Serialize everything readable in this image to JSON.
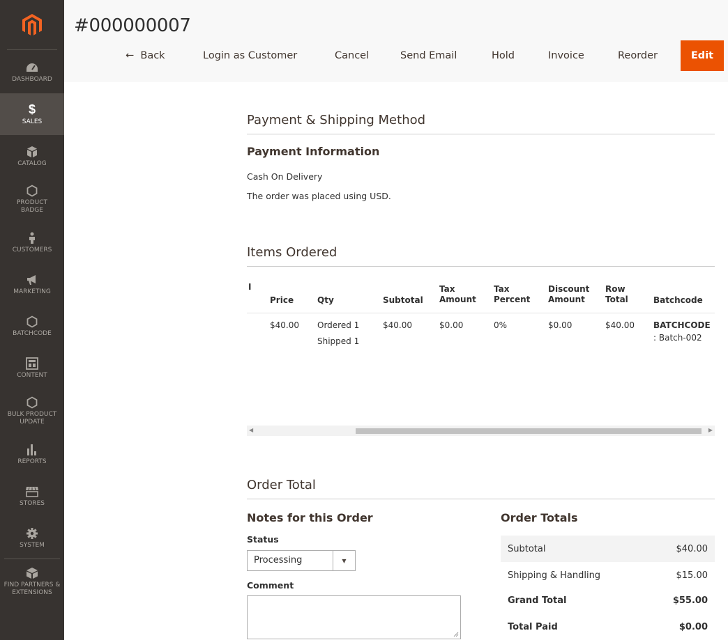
{
  "sidebar": {
    "items": [
      {
        "label": "DASHBOARD",
        "icon": "dashboard-icon"
      },
      {
        "label": "SALES",
        "icon": "dollar-icon",
        "glyph": "$"
      },
      {
        "label": "CATALOG",
        "icon": "box-icon"
      },
      {
        "label": "PRODUCT BADGE",
        "icon": "hexagon-icon"
      },
      {
        "label": "CUSTOMERS",
        "icon": "person-icon"
      },
      {
        "label": "MARKETING",
        "icon": "megaphone-icon"
      },
      {
        "label": "BATCHCODE",
        "icon": "hexagon-icon"
      },
      {
        "label": "CONTENT",
        "icon": "layout-icon"
      },
      {
        "label": "BULK PRODUCT UPDATE",
        "icon": "hexagon-icon"
      },
      {
        "label": "REPORTS",
        "icon": "bar-chart-icon"
      },
      {
        "label": "STORES",
        "icon": "store-icon"
      },
      {
        "label": "SYSTEM",
        "icon": "gear-icon"
      },
      {
        "label": "FIND PARTNERS & EXTENSIONS",
        "icon": "cube-icon"
      }
    ]
  },
  "header": {
    "title": "#000000007",
    "back": "Back",
    "login": "Login as Customer",
    "cancel": "Cancel",
    "send_email": "Send Email",
    "hold": "Hold",
    "invoice": "Invoice",
    "reorder": "Reorder",
    "edit": "Edit"
  },
  "payment": {
    "section_title": "Payment & Shipping Method",
    "sub_title": "Payment Information",
    "method": "Cash On Delivery",
    "currency_note": "The order was placed using USD."
  },
  "items": {
    "section_title": "Items Ordered",
    "col_first": "I",
    "headers": {
      "price": "Price",
      "qty": "Qty",
      "subtotal": "Subtotal",
      "tax_amount": "Tax Amount",
      "tax_percent": "Tax Percent",
      "discount": "Discount Amount",
      "row_total": "Row Total",
      "batchcode": "Batchcode"
    },
    "row": {
      "price": "$40.00",
      "qty_ordered": "Ordered 1",
      "qty_shipped": "Shipped 1",
      "subtotal": "$40.00",
      "tax_amount": "$0.00",
      "tax_percent": "0%",
      "discount": "$0.00",
      "row_total": "$40.00",
      "batchcode_label": "BATCHCODE",
      "batchcode_value": ": Batch-002"
    }
  },
  "order_total": {
    "section_title": "Order Total",
    "notes_title": "Notes for this Order",
    "status_label": "Status",
    "status_value": "Processing",
    "comment_label": "Comment",
    "totals_title": "Order Totals",
    "rows": [
      {
        "label": "Subtotal",
        "value": "$40.00"
      },
      {
        "label": "Shipping & Handling",
        "value": "$15.00"
      },
      {
        "label": "Grand Total",
        "value": "$55.00"
      },
      {
        "label": "Total Paid",
        "value": "$0.00"
      }
    ]
  }
}
